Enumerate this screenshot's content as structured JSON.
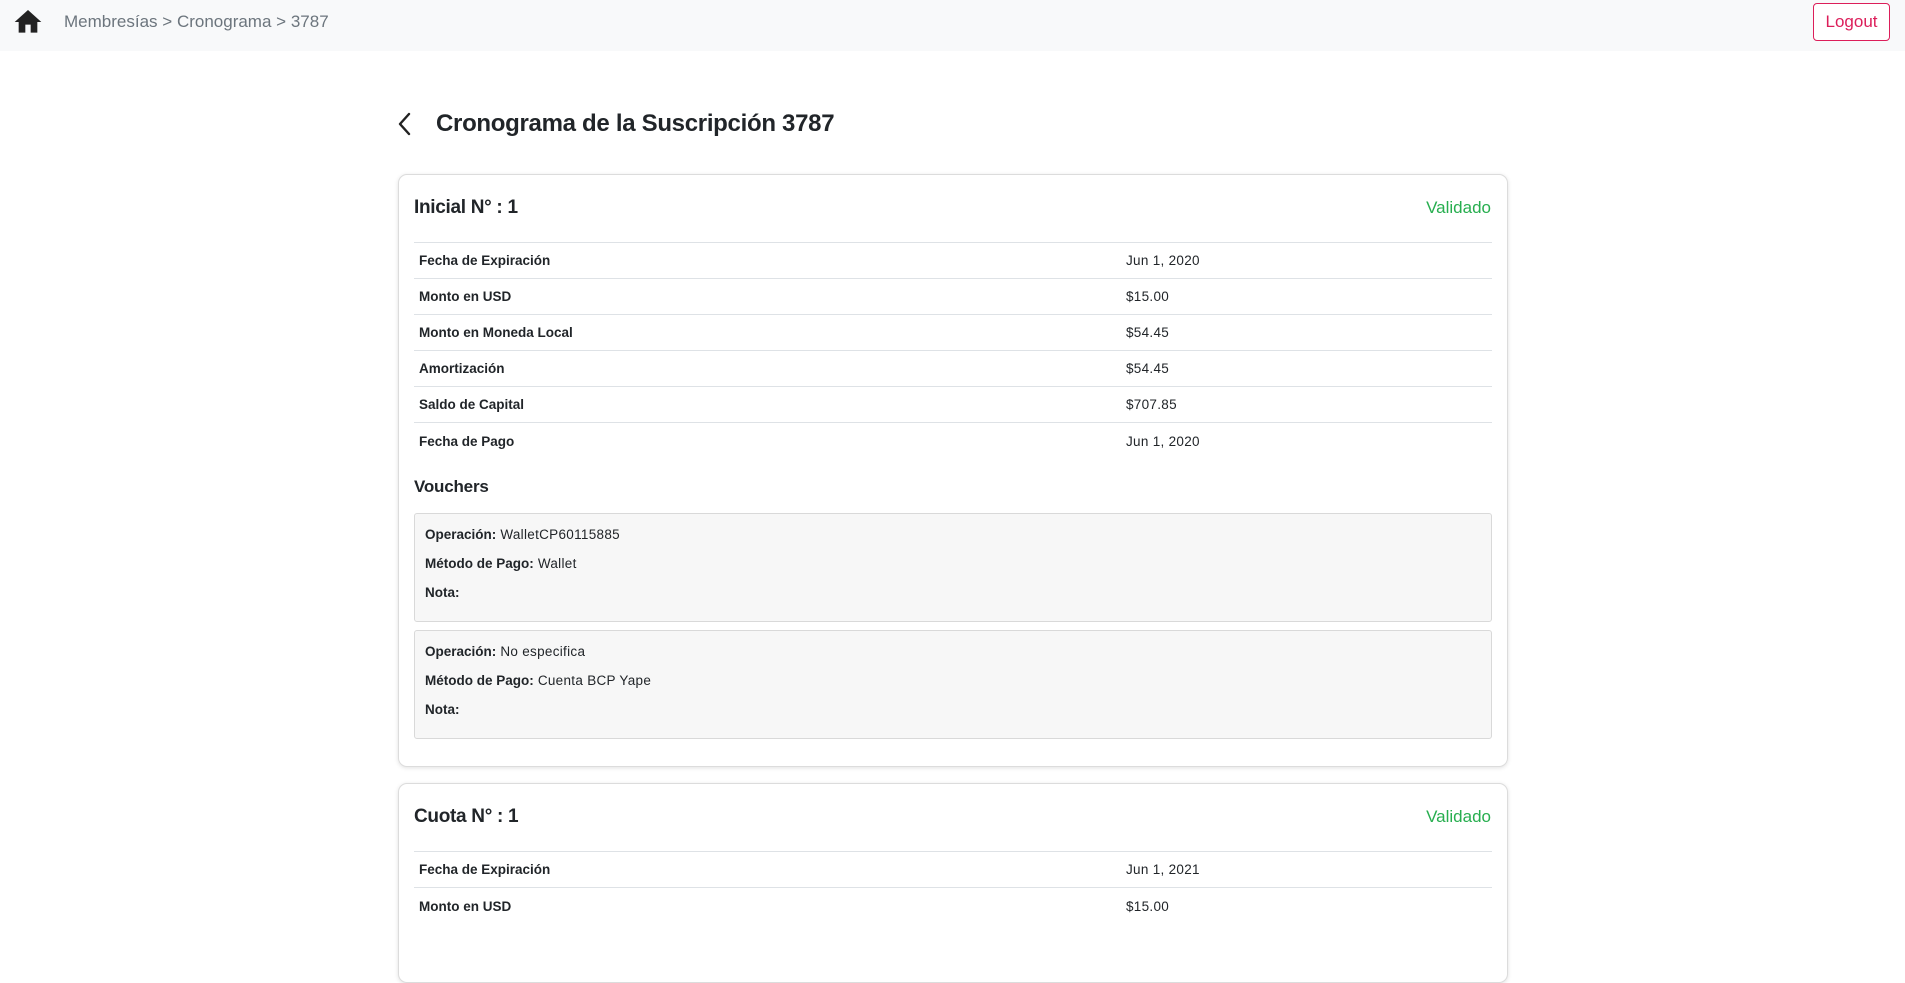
{
  "nav": {
    "breadcrumb": [
      "Membresías",
      "Cronograma",
      "3787"
    ],
    "separator": ">",
    "logout_label": "Logout"
  },
  "page": {
    "title": "Cronograma de la Suscripción 3787"
  },
  "colors": {
    "status_validated": "#27ae4f",
    "logout_accent": "#dc1e5a"
  },
  "icons": {
    "home": "home-icon",
    "back": "chevron-left-icon"
  },
  "cards": [
    {
      "title": "Inicial N° : 1",
      "status": "Validado",
      "rows": [
        {
          "label": "Fecha de Expiración",
          "value": "Jun 1, 2020"
        },
        {
          "label": "Monto en USD",
          "value": "$15.00"
        },
        {
          "label": "Monto en Moneda Local",
          "value": "$54.45"
        },
        {
          "label": "Amortización",
          "value": "$54.45"
        },
        {
          "label": "Saldo de Capital",
          "value": "$707.85"
        },
        {
          "label": "Fecha de Pago",
          "value": "Jun 1, 2020"
        }
      ],
      "vouchers_title": "Vouchers",
      "vouchers": [
        {
          "operation_label": "Operación:",
          "operation": "WalletCP60115885",
          "method_label": "Método de Pago:",
          "method": "Wallet",
          "note_label": "Nota:",
          "note": ""
        },
        {
          "operation_label": "Operación:",
          "operation": "No especifica",
          "method_label": "Método de Pago:",
          "method": "Cuenta BCP Yape",
          "note_label": "Nota:",
          "note": ""
        }
      ]
    },
    {
      "title": "Cuota N° : 1",
      "status": "Validado",
      "rows": [
        {
          "label": "Fecha de Expiración",
          "value": "Jun 1, 2021"
        },
        {
          "label": "Monto en USD",
          "value": "$15.00"
        }
      ]
    }
  ]
}
